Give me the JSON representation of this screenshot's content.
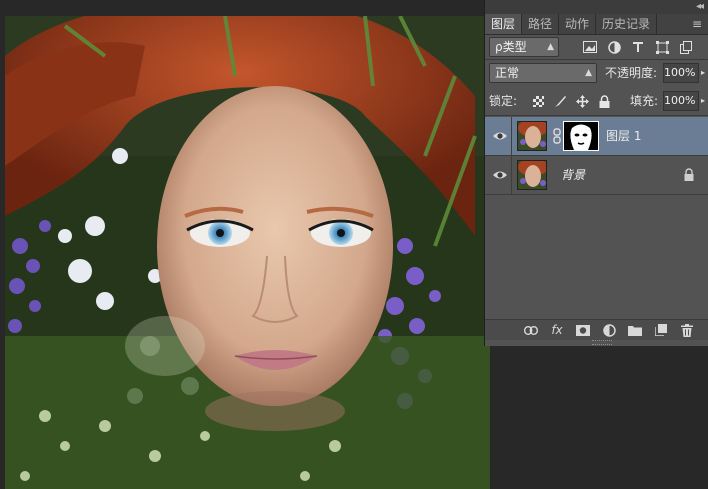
{
  "panel": {
    "tabs": [
      {
        "label": "图层",
        "active": true
      },
      {
        "label": "路径",
        "active": false
      },
      {
        "label": "动作",
        "active": false
      },
      {
        "label": "历史记录",
        "active": false
      }
    ],
    "menu_icon": "panel-menu-icon",
    "filter": {
      "kind_label": "ρ类型",
      "icons": [
        "pixel-filter-icon",
        "adjustment-filter-icon",
        "type-filter-icon",
        "shape-filter-icon",
        "smart-object-filter-icon"
      ]
    },
    "blend": {
      "mode": "正常",
      "opacity_label": "不透明度:",
      "opacity_value": "100%"
    },
    "lock": {
      "label": "锁定:",
      "icons": [
        "lock-transparent-icon",
        "lock-image-icon",
        "lock-position-icon",
        "lock-all-icon"
      ],
      "fill_label": "填充:",
      "fill_value": "100%"
    },
    "layers": [
      {
        "name": "图层 1",
        "visible": true,
        "selected": true,
        "has_mask": true
      },
      {
        "name": "背景",
        "visible": true,
        "selected": false,
        "locked": true
      }
    ],
    "bottom_icons": [
      "link-layers-icon",
      "fx-icon",
      "add-mask-icon",
      "adjustment-layer-icon",
      "new-group-icon",
      "new-layer-icon",
      "delete-layer-icon"
    ],
    "fx_label": "fx",
    "colors": {
      "panel_bg": "#535353",
      "selected_row": "#6b7d94",
      "canvas_bg": "#282828"
    }
  }
}
